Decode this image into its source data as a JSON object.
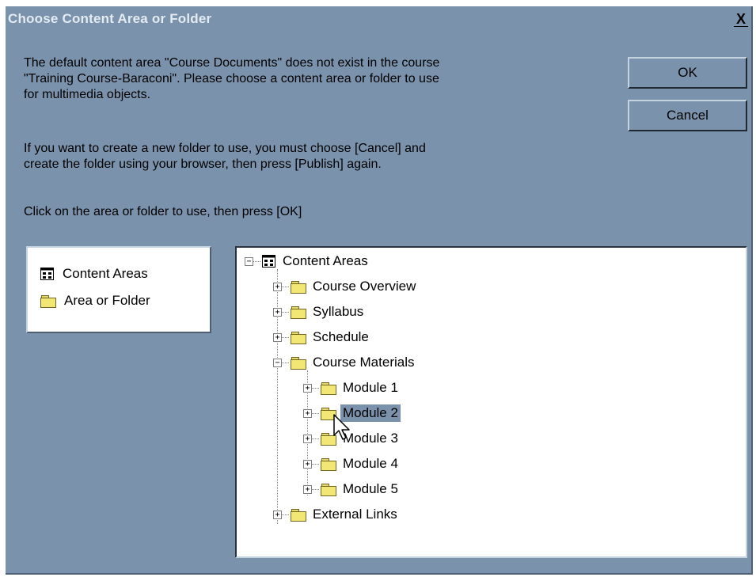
{
  "dialog": {
    "title": "Choose Content Area or Folder",
    "close_label": "X"
  },
  "message": {
    "paragraph1": "The default content area \"Course Documents\" does not exist in the course\n\"Training Course-Baraconi\". Please choose a content area or folder to use\nfor multimedia objects.",
    "paragraph2": "If you want to create a new folder to use, you must choose [Cancel] and\ncreate the folder using your browser, then press [Publish] again.",
    "paragraph3": "Click on the area or folder to use, then press [OK]"
  },
  "buttons": {
    "ok_label": "OK",
    "cancel_label": "Cancel"
  },
  "legend": {
    "items": [
      {
        "label": "Content Areas",
        "icon": "content-areas-icon"
      },
      {
        "label": "Area or Folder",
        "icon": "folder-icon"
      }
    ]
  },
  "tree": {
    "root": {
      "label": "Content Areas",
      "expander": "−"
    },
    "items": [
      {
        "label": "Course Overview",
        "expander": "+"
      },
      {
        "label": "Syllabus",
        "expander": "+"
      },
      {
        "label": "Schedule",
        "expander": "+"
      },
      {
        "label": "Course Materials",
        "expander": "−"
      },
      {
        "label": "Module 1",
        "expander": "+"
      },
      {
        "label": "Module 2",
        "expander": "+",
        "selected": true
      },
      {
        "label": "Module 3",
        "expander": "+"
      },
      {
        "label": "Module 4",
        "expander": "+"
      },
      {
        "label": "Module 5",
        "expander": "+"
      },
      {
        "label": "External Links",
        "expander": "+"
      }
    ]
  },
  "colors": {
    "dialog_bg": "#7b92ac",
    "selection_bg": "#7b92ac",
    "folder_yellow": "#f2e674"
  }
}
